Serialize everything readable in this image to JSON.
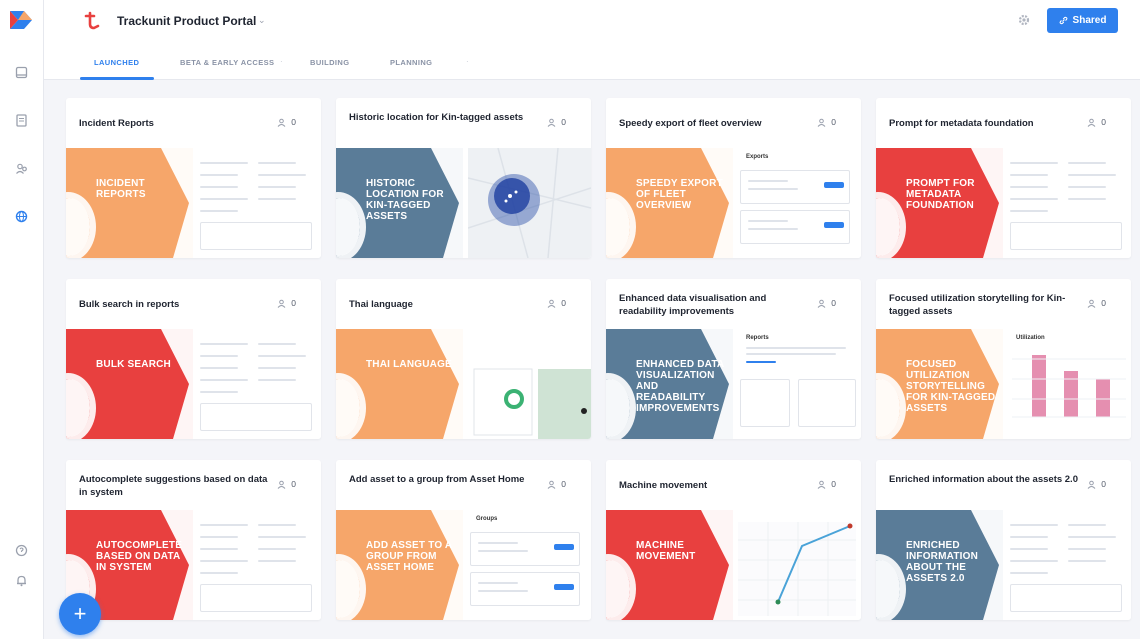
{
  "app": {
    "title": "Trackunit Product Portal"
  },
  "header": {
    "shared_label": "Shared",
    "icons": [
      "gear-icon",
      "link-icon"
    ]
  },
  "tabs": [
    {
      "label": "LAUNCHED",
      "active": true
    },
    {
      "label": "BETA & EARLY ACCESS",
      "active": false
    },
    {
      "label": "BUILDING",
      "active": false
    },
    {
      "label": "PLANNING",
      "active": false
    }
  ],
  "colors": {
    "accent": "#2f80ed",
    "orange": "#f6a66a",
    "blue": "#5a7c98",
    "red": "#e8403f"
  },
  "cards": [
    {
      "title": "Incident Reports",
      "count": "0",
      "banner": "INCIDENT REPORTS",
      "color": "orange"
    },
    {
      "title": "Historic location for Kin-tagged assets",
      "count": "0",
      "banner": "HISTORIC LOCATION FOR KIN-TAGGED ASSETS",
      "color": "blue"
    },
    {
      "title": "Speedy export of fleet overview",
      "count": "0",
      "banner": "SPEEDY EXPORT OF FLEET OVERVIEW",
      "color": "orange",
      "shot_header": "Exports"
    },
    {
      "title": "Prompt for metadata foundation",
      "count": "0",
      "banner": "PROMPT FOR METADATA FOUNDATION",
      "color": "red"
    },
    {
      "title": "Bulk search in reports",
      "count": "0",
      "banner": "BULK SEARCH",
      "color": "red"
    },
    {
      "title": "Thai language",
      "count": "0",
      "banner": "THAI LANGUAGE",
      "color": "orange"
    },
    {
      "title": "Enhanced data visualisation and readability improvements",
      "count": "0",
      "banner": "ENHANCED DATA VISUALIZATION AND READABILITY IMPROVEMENTS",
      "color": "blue",
      "shot_header": "Reports"
    },
    {
      "title": "Focused utilization storytelling for Kin-tagged assets",
      "count": "0",
      "banner": "FOCUSED UTILIZATION STORYTELLING FOR KIN-TAGGED ASSETS",
      "color": "orange",
      "shot_header": "Utilization"
    },
    {
      "title": "Autocomplete suggestions based on data in system",
      "count": "0",
      "banner": "AUTOCOMPLETE BASED ON DATA IN SYSTEM",
      "color": "red"
    },
    {
      "title": "Add asset to a group from Asset Home",
      "count": "0",
      "banner": "ADD ASSET TO A GROUP FROM ASSET HOME",
      "color": "orange",
      "shot_header": "Groups"
    },
    {
      "title": "Machine movement",
      "count": "0",
      "banner": "MACHINE MOVEMENT",
      "color": "red"
    },
    {
      "title": "Enriched information about the assets 2.0",
      "count": "0",
      "banner": "ENRICHED INFORMATION ABOUT THE ASSETS 2.0",
      "color": "blue"
    }
  ],
  "fab": {
    "label": "+"
  },
  "rail_icons": [
    "box-icon",
    "document-icon",
    "people-icon",
    "globe-icon",
    "help-icon",
    "bell-icon"
  ]
}
